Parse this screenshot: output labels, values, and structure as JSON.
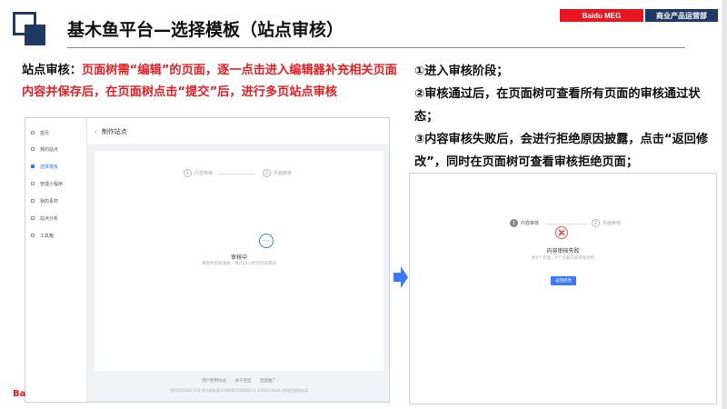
{
  "header": {
    "title": "基木鱼平台—选择模板（站点审核）",
    "brand_left": "Baidu MEG",
    "brand_right": "商业产品运营部"
  },
  "description": {
    "lead": "站点审核：",
    "body": "页面树需“编辑”的页面，逐一点击进入编辑器补充相关页面内容并保存后，在页面树点击“提交”后，进行多页站点审核"
  },
  "steps": [
    "①进入审核阶段；",
    "②审核通过后，在页面树可查看所有页面的审核通过状态；",
    "③内容审核失败后，会进行拒绝原因披露，点击“返回修改”，同时在页面树可查看审核拒绝页面；"
  ],
  "bottom_clip": "Ba",
  "left_screenshot": {
    "sidebar": [
      {
        "label": "首页",
        "active": false
      },
      {
        "label": "我的站点",
        "active": false
      },
      {
        "label": "选择模板",
        "active": true
      },
      {
        "label": "管理小程序",
        "active": false
      },
      {
        "label": "我的素材",
        "active": false
      },
      {
        "label": "站点分析",
        "active": false
      },
      {
        "label": "工具箱",
        "active": false
      }
    ],
    "back_glyph": "‹",
    "page_header": "制作站点",
    "step1_num": "1",
    "step1_label": "内容审核",
    "step2_num": "2",
    "step2_label": "页面审核",
    "status_glyph": "···",
    "status_title": "审核中",
    "status_sub": "请等待审核通知，预计24小时内完成审核",
    "footer_links": [
      "用户使用协议",
      "关于百度",
      "百度推广"
    ],
    "footer_copy": "京ICP证030173号 京公网安备11000002000001号 ©2020 Baidu 使用百度前必读"
  },
  "right_screenshot": {
    "step1_num": "1",
    "step1_label": "内容审核",
    "step2_num": "2",
    "step2_label": "页面审核",
    "status_title": "内容审核失败",
    "status_sub": "共X个页面，X个页面内容审核拒绝",
    "button_label": "返回修改"
  },
  "colors": {
    "brand_red": "#e8161e",
    "navy": "#1f3864",
    "accent_blue": "#3a7afe",
    "fail_red": "#f15555"
  }
}
